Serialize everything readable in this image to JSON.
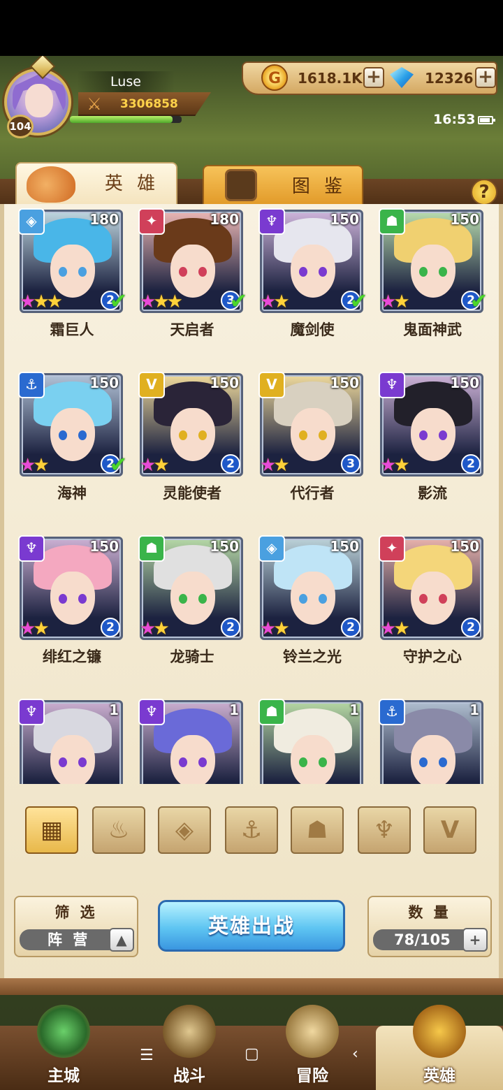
{
  "player": {
    "name": "Luse",
    "level": "104",
    "power": "3306858"
  },
  "resources": {
    "gold": "1618.1K",
    "gems": "12326",
    "coin_symbol": "G"
  },
  "status": {
    "time": "16:53"
  },
  "tabs": [
    {
      "label": "英 雄"
    },
    {
      "label": "图 鉴"
    }
  ],
  "help_symbol": "?",
  "heroes": [
    {
      "name": "霜巨人",
      "level": "180",
      "faction": "crystal",
      "stars": 3,
      "rank": "2",
      "check": true,
      "color": "#4aa0e0",
      "hair": "#49b6e8"
    },
    {
      "name": "天启者",
      "level": "180",
      "faction": "flame",
      "stars": 3,
      "rank": "3",
      "check": true,
      "color": "#d0405a",
      "hair": "#6a3a1a"
    },
    {
      "name": "魔剑使",
      "level": "150",
      "faction": "demon",
      "stars": 2,
      "rank": "2",
      "check": true,
      "color": "#7a3ad0",
      "hair": "#e6e6ee"
    },
    {
      "name": "鬼面神武",
      "level": "150",
      "faction": "beast",
      "stars": 2,
      "rank": "2",
      "check": true,
      "color": "#3ab44a",
      "hair": "#f0d070"
    },
    {
      "name": "海神",
      "level": "150",
      "faction": "anchor",
      "stars": 2,
      "rank": "2",
      "check": true,
      "color": "#2a6ad0",
      "hair": "#7ad0f0"
    },
    {
      "name": "灵能使者",
      "level": "150",
      "faction": "light",
      "stars": 2,
      "rank": "2",
      "check": false,
      "color": "#e0b020",
      "hair": "#2a2438"
    },
    {
      "name": "代行者",
      "level": "150",
      "faction": "light",
      "stars": 2,
      "rank": "3",
      "check": false,
      "color": "#e0b020",
      "hair": "#d8d0c0"
    },
    {
      "name": "影流",
      "level": "150",
      "faction": "demon",
      "stars": 2,
      "rank": "2",
      "check": false,
      "color": "#7a3ad0",
      "hair": "#22202a"
    },
    {
      "name": "绯红之镰",
      "level": "150",
      "faction": "demon",
      "stars": 2,
      "rank": "2",
      "check": false,
      "color": "#7a3ad0",
      "hair": "#f4a8c0"
    },
    {
      "name": "龙骑士",
      "level": "150",
      "faction": "beast",
      "stars": 2,
      "rank": "2",
      "check": false,
      "color": "#3ab44a",
      "hair": "#e0e0e0"
    },
    {
      "name": "铃兰之光",
      "level": "150",
      "faction": "crystal",
      "stars": 2,
      "rank": "2",
      "check": false,
      "color": "#4aa0e0",
      "hair": "#bfe4f6"
    },
    {
      "name": "守护之心",
      "level": "150",
      "faction": "flame",
      "stars": 2,
      "rank": "2",
      "check": false,
      "color": "#d0405a",
      "hair": "#f4d67a"
    },
    {
      "name": "",
      "level": "1",
      "faction": "demon",
      "stars": 0,
      "rank": "",
      "check": false,
      "color": "#7a3ad0",
      "hair": "#d8d8e0"
    },
    {
      "name": "",
      "level": "1",
      "faction": "demon",
      "stars": 0,
      "rank": "",
      "check": false,
      "color": "#7a3ad0",
      "hair": "#6a6ad8"
    },
    {
      "name": "",
      "level": "1",
      "faction": "beast",
      "stars": 0,
      "rank": "",
      "check": false,
      "color": "#3ab44a",
      "hair": "#f0ece0"
    },
    {
      "name": "",
      "level": "1",
      "faction": "anchor",
      "stars": 0,
      "rank": "",
      "check": false,
      "color": "#2a6ad0",
      "hair": "#8a8aa8"
    }
  ],
  "filters": [
    {
      "icon": "all-grid-icon",
      "glyph": "▦",
      "active": true
    },
    {
      "icon": "flame-faction-icon",
      "glyph": "♨",
      "active": false
    },
    {
      "icon": "crystal-faction-icon",
      "glyph": "◈",
      "active": false
    },
    {
      "icon": "anchor-faction-icon",
      "glyph": "⚓",
      "active": false
    },
    {
      "icon": "beast-faction-icon",
      "glyph": "☗",
      "active": false
    },
    {
      "icon": "demon-faction-icon",
      "glyph": "♆",
      "active": false
    },
    {
      "icon": "light-faction-icon",
      "glyph": "V",
      "active": false
    }
  ],
  "controls": {
    "filter_title": "筛 选",
    "filter_value": "阵 营",
    "deploy_label": "英雄出战",
    "count_title": "数 量",
    "count_value": "78/105"
  },
  "nav": [
    {
      "label": "主城"
    },
    {
      "label": "战斗"
    },
    {
      "label": "冒险"
    },
    {
      "label": "英雄"
    }
  ],
  "faction_glyphs": {
    "crystal": "◈",
    "flame": "✦",
    "demon": "♆",
    "beast": "☗",
    "anchor": "⚓",
    "light": "V"
  }
}
